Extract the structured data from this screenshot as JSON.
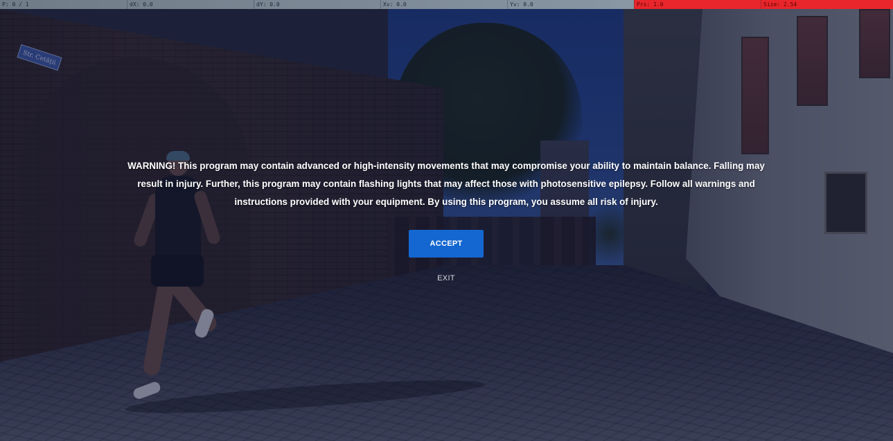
{
  "debug_bar": {
    "p": "P: 0 / 1",
    "dx": "dX: 0.0",
    "dy": "dY: 0.0",
    "xv": "Xv: 0.0",
    "yv": "Yv: 0.0",
    "prs": "Prs: 1.0",
    "size": "Size: 2.54",
    "alert_color": "#e8262b"
  },
  "background": {
    "street_sign": "Str. Cetății",
    "tint_color": "#12183a"
  },
  "warning": {
    "text": "WARNING! This program may contain advanced or high-intensity movements that may compromise your ability to maintain balance. Falling may result in injury. Further, this program may contain flashing lights that may affect those with photosensitive epilepsy. Follow all warnings and instructions provided with your equipment. By using this program, you assume all risk of injury.",
    "accept_label": "ACCEPT",
    "exit_label": "EXIT",
    "accent_color": "#1467d1"
  }
}
